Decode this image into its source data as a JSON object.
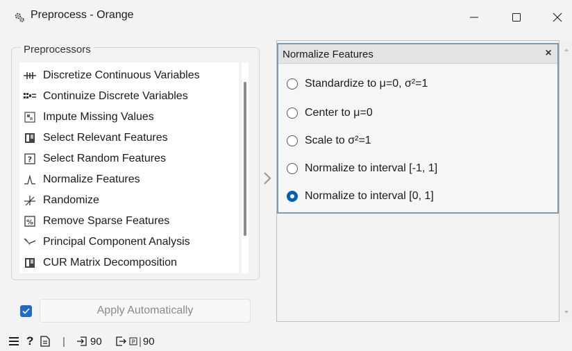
{
  "window": {
    "title": "Preprocess - Orange",
    "icon": "orange-gears-icon",
    "controls": [
      "minimize-icon",
      "maximize-icon",
      "close-icon"
    ],
    "minimize_glyph": "—",
    "maximize_glyph": "☐",
    "close_glyph": "X"
  },
  "preprocessors": {
    "group_title": "Preprocessors",
    "items": [
      {
        "label": "Discretize Continuous Variables",
        "icon": "discretize-icon"
      },
      {
        "label": "Continuize Discrete Variables",
        "icon": "continuize-icon"
      },
      {
        "label": "Impute Missing Values",
        "icon": "impute-icon"
      },
      {
        "label": "Select Relevant Features",
        "icon": "select-relevant-icon"
      },
      {
        "label": "Select Random Features",
        "icon": "select-random-icon"
      },
      {
        "label": "Normalize Features",
        "icon": "normalize-icon"
      },
      {
        "label": "Randomize",
        "icon": "randomize-icon"
      },
      {
        "label": "Remove Sparse Features",
        "icon": "remove-sparse-icon"
      },
      {
        "label": "Principal Component Analysis",
        "icon": "pca-icon"
      },
      {
        "label": "CUR Matrix Decomposition",
        "icon": "cur-icon"
      }
    ]
  },
  "normalize_panel": {
    "title": "Normalize Features",
    "close_glyph": "×",
    "options": [
      {
        "label": "Standardize to μ=0, σ²=1",
        "checked": false
      },
      {
        "label": "Center to μ=0",
        "checked": false
      },
      {
        "label": "Scale to σ²=1",
        "checked": false
      },
      {
        "label": "Normalize to interval [-1, 1]",
        "checked": false
      },
      {
        "label": "Normalize to interval [0, 1]",
        "checked": true
      }
    ]
  },
  "apply": {
    "checked": true,
    "label": "Apply Automatically"
  },
  "statusbar": {
    "menu_icon": "hamburger-menu-icon",
    "help_icon": "help-icon",
    "report_icon": "report-icon",
    "input_count": "90",
    "output_count": "90",
    "separator": "|",
    "help_glyph": "?"
  },
  "colors": {
    "accent": "#005fb8",
    "panel_border": "#7a9bb5",
    "background": "#f3f3f3"
  }
}
